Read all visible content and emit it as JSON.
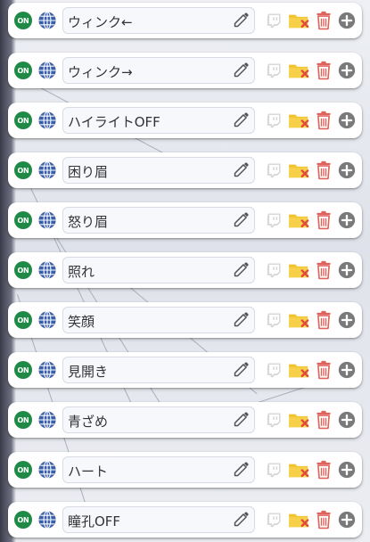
{
  "rows": [
    {
      "status": "ON",
      "name": "ウィンク←"
    },
    {
      "status": "ON",
      "name": "ウィンク→"
    },
    {
      "status": "ON",
      "name": "ハイライトOFF"
    },
    {
      "status": "ON",
      "name": "困り眉"
    },
    {
      "status": "ON",
      "name": "怒り眉"
    },
    {
      "status": "ON",
      "name": "照れ"
    },
    {
      "status": "ON",
      "name": "笑顔"
    },
    {
      "status": "ON",
      "name": "見開き"
    },
    {
      "status": "ON",
      "name": "青ざめ"
    },
    {
      "status": "ON",
      "name": "ハート"
    },
    {
      "status": "ON",
      "name": "瞳孔OFF"
    }
  ],
  "icons": {
    "status": "on-badge-icon",
    "scope": "globe-icon",
    "edit": "pencil-icon",
    "twitch": "twitch-icon",
    "folder_remove": "folder-remove-icon",
    "delete": "trash-icon",
    "add": "plus-circle-icon"
  },
  "colors": {
    "on_badge": "#1f8a45",
    "globe": "#3a5fa8",
    "folder": "#f2c230",
    "folder_x": "#e0493b",
    "trash": "#e0625a",
    "plus": "#7a7a7a",
    "twitch": "#d8d8d8"
  }
}
